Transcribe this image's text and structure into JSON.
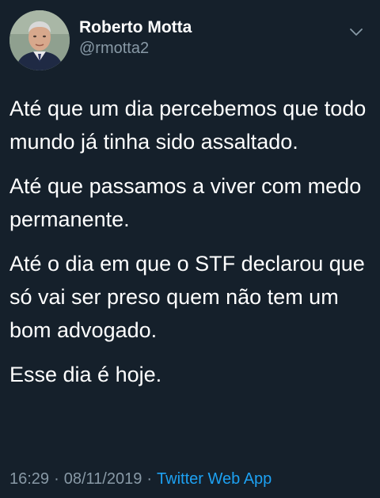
{
  "author": {
    "display_name": "Roberto Motta",
    "handle": "@rmotta2"
  },
  "tweet": {
    "paragraphs": [
      "Até que um dia percebemos que todo mundo já tinha sido assaltado.",
      "Até que passamos a viver com medo permanente.",
      "Até o dia em que o STF declarou que só vai ser preso quem não tem um bom advogado.",
      "Esse dia é hoje."
    ],
    "time": "16:29",
    "separator": "·",
    "date": "08/11/2019",
    "source": "Twitter Web App"
  },
  "icons": {
    "more": "chevron-down-icon"
  },
  "colors": {
    "background": "#15202b",
    "primary_text": "#ffffff",
    "secondary_text": "#8899a6",
    "accent": "#1da1f2"
  }
}
